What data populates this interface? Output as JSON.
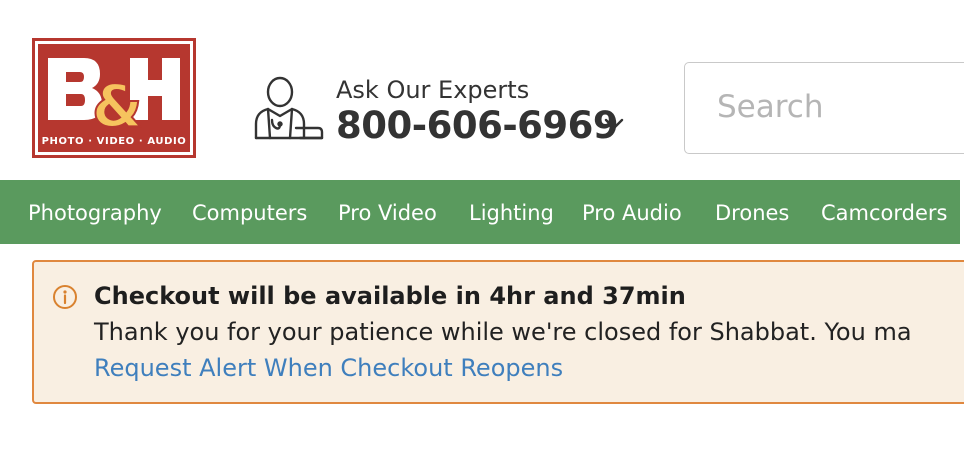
{
  "logo": {
    "brand": "B&H",
    "tagline": "PHOTO · VIDEO · AUDIO",
    "brand_color": "#b6372f",
    "accent_color": "#f6c35e"
  },
  "experts": {
    "title": "Ask Our Experts",
    "phone": "800-606-6969",
    "icon": "support-agent-icon",
    "dropdown_icon": "chevron-down-icon"
  },
  "search": {
    "placeholder": "Search",
    "value": ""
  },
  "nav": {
    "background_color": "#5a9a5e",
    "items": [
      {
        "label": "Photography"
      },
      {
        "label": "Computers"
      },
      {
        "label": "Pro Video"
      },
      {
        "label": "Lighting"
      },
      {
        "label": "Pro Audio"
      },
      {
        "label": "Drones"
      },
      {
        "label": "Camcorders"
      }
    ]
  },
  "notice": {
    "icon": "info-icon",
    "title": "Checkout will be available in 4hr and 37min",
    "message": "Thank you for your patience while we're closed for Shabbat. You ma",
    "link": "Request Alert When Checkout Reopens",
    "border_color": "#e0883f",
    "background_color": "#f9efe2",
    "link_color": "#3f7fbd"
  }
}
